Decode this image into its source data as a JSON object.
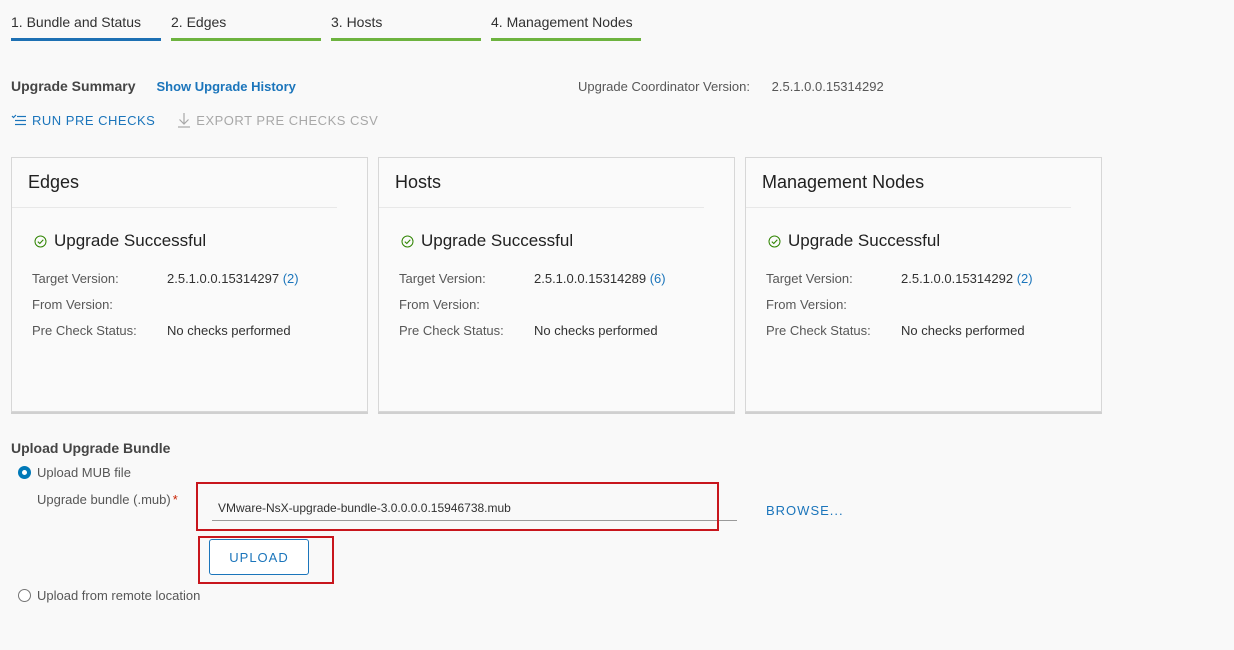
{
  "tabs": [
    {
      "label": "1. Bundle and Status",
      "active": true
    },
    {
      "label": "2. Edges",
      "active": false
    },
    {
      "label": "3. Hosts",
      "active": false
    },
    {
      "label": "4. Management Nodes",
      "active": false
    }
  ],
  "summary": {
    "title": "Upgrade Summary",
    "history_link": "Show Upgrade History",
    "coordinator_label": "Upgrade Coordinator Version:",
    "coordinator_version": "2.5.1.0.0.15314292"
  },
  "actions": {
    "run_pre_checks": "RUN PRE CHECKS",
    "export_csv": "EXPORT PRE CHECKS CSV"
  },
  "cards": [
    {
      "title": "Edges",
      "status": "Upgrade Successful",
      "target_label": "Target Version:",
      "target_version": "2.5.1.0.0.15314297",
      "target_count": "(2)",
      "from_label": "From Version:",
      "from_version": "",
      "precheck_label": "Pre Check Status:",
      "precheck_status": "No checks performed"
    },
    {
      "title": "Hosts",
      "status": "Upgrade Successful",
      "target_label": "Target Version:",
      "target_version": "2.5.1.0.0.15314289",
      "target_count": "(6)",
      "from_label": "From Version:",
      "from_version": "",
      "precheck_label": "Pre Check Status:",
      "precheck_status": "No checks performed"
    },
    {
      "title": "Management Nodes",
      "status": "Upgrade Successful",
      "target_label": "Target Version:",
      "target_version": "2.5.1.0.0.15314292",
      "target_count": "(2)",
      "from_label": "From Version:",
      "from_version": "",
      "precheck_label": "Pre Check Status:",
      "precheck_status": "No checks performed"
    }
  ],
  "upload": {
    "title": "Upload Upgrade Bundle",
    "option_mub": "Upload MUB file",
    "option_remote": "Upload from remote location",
    "field_label": "Upgrade bundle (.mub)",
    "required_mark": "*",
    "file_value": "VMware-NsX-upgrade-bundle-3.0.0.0.0.15946738.mub",
    "browse_label": "BROWSE...",
    "upload_label": "UPLOAD"
  },
  "colors": {
    "accent": "#1b75bb",
    "tab_done": "#6db33f",
    "success": "#2f8400",
    "highlight": "#c8161d"
  }
}
